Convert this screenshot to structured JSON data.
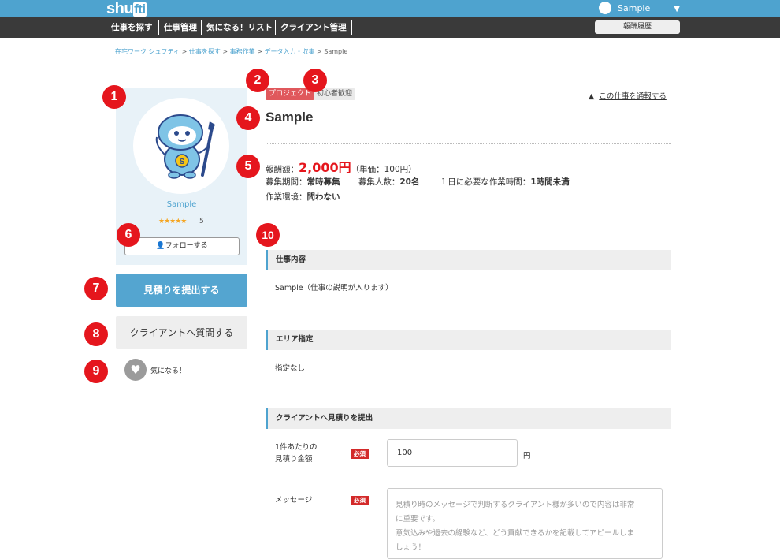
{
  "header": {
    "logo_a": "shu",
    "logo_b": "fti",
    "user_name": "Sample",
    "user_menu_icon": "chevron-down-icon"
  },
  "nav": {
    "items": [
      "仕事を探す",
      "仕事管理",
      "気になる！リスト",
      "クライアント管理"
    ],
    "history_button": "報酬履歴"
  },
  "breadcrumb": {
    "items": [
      "在宅ワーク シュフティ",
      "仕事を探す",
      "事務作業",
      "データ入力・収集"
    ],
    "current": "Sample",
    "separator": ">"
  },
  "badges": [
    "1",
    "2",
    "3",
    "4",
    "5",
    "6",
    "7",
    "8",
    "9",
    "10"
  ],
  "client": {
    "name": "Sample",
    "stars": "★★★★★",
    "rating": "5",
    "follow_label": "フォローする"
  },
  "actions": {
    "quote_button": "見積りを提出する",
    "ask_button": "クライアントへ質問する",
    "like_label": "気になる！"
  },
  "job": {
    "tag_project": "プロジェクト",
    "tag_beginner": "初心者歓迎",
    "report_link": "この仕事を通報する",
    "title": "Sample",
    "reward_label": "報酬額：",
    "reward_value": "2,000円",
    "unit_price": "（単価：100円）",
    "period_label": "募集期間：",
    "period_value": "常時募集",
    "count_label": "募集人数：",
    "count_value": "20名",
    "hours_label": "１日に必要な作業時間：",
    "hours_value": "1時間未満",
    "env_label": "作業環境：",
    "env_value": "問わない"
  },
  "sections": {
    "content_title": "仕事内容",
    "content_text": "Sample（仕事の説明が入ります）",
    "area_title": "エリア指定",
    "area_text": "指定なし",
    "quote_title": "クライアントへ見積りを提出"
  },
  "form": {
    "amount_label_1": "1件あたりの",
    "amount_label_2": "見積り金額",
    "required": "必須",
    "amount_value": "100",
    "yen": "円",
    "message_label": "メッセージ",
    "message_placeholder_1": "見積り時のメッセージで判断するクライアント様が多いので内容は非常",
    "message_placeholder_2": "に重要です。",
    "message_placeholder_3": "意気込みや過去の経験など、どう貢献できるかを記載してアピールしま",
    "message_placeholder_4": "しょう！"
  },
  "colors": {
    "brand": "#4ea3cf",
    "nav_bg": "#3a3a3a",
    "badge": "#e5161d",
    "price": "#e5161d"
  }
}
